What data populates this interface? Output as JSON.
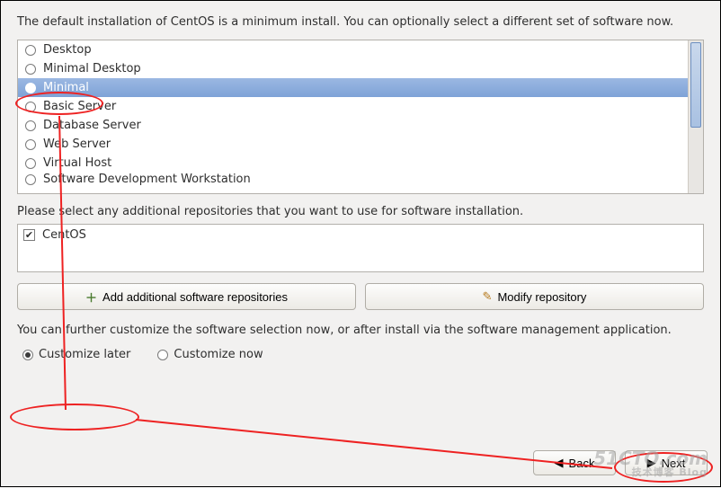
{
  "intro": "The default installation of CentOS is a minimum install. You can optionally select a different set of software now.",
  "software_options": [
    {
      "label": "Desktop",
      "selected": false
    },
    {
      "label": "Minimal Desktop",
      "selected": false
    },
    {
      "label": "Minimal",
      "selected": true
    },
    {
      "label": "Basic Server",
      "selected": false
    },
    {
      "label": "Database Server",
      "selected": false
    },
    {
      "label": "Web Server",
      "selected": false
    },
    {
      "label": "Virtual Host",
      "selected": false
    },
    {
      "label": "Software Development Workstation",
      "selected": false
    }
  ],
  "repo_prompt": "Please select any additional repositories that you want to use for software installation.",
  "repos": [
    {
      "label": "CentOS",
      "checked": true
    }
  ],
  "buttons": {
    "add_repo": "Add additional software repositories",
    "modify_repo": "Modify repository"
  },
  "customize_text": "You can further customize the software selection now, or after install via the software management application.",
  "customize_options": {
    "later": "Customize later",
    "now": "Customize now",
    "selected": "later"
  },
  "nav": {
    "back": "Back",
    "next": "Next"
  },
  "watermark": {
    "main": "51CTO.com",
    "sub": "技术博客 Blog"
  }
}
